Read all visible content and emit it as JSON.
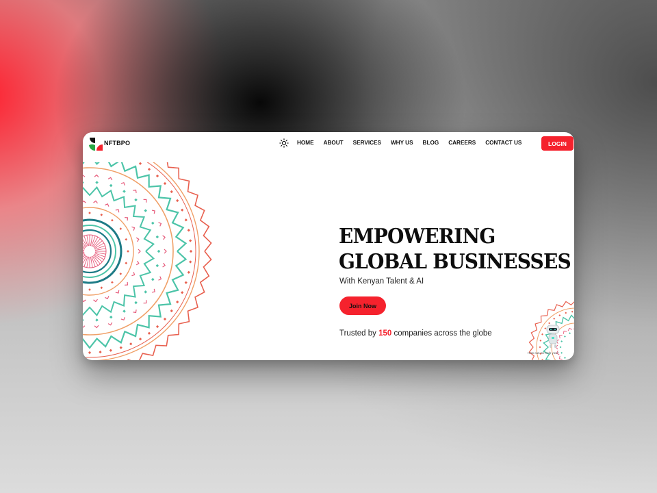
{
  "brand": {
    "name": "NFTBPO",
    "colors": {
      "red": "#f5222d",
      "green": "#27a844",
      "black": "#111111",
      "teal": "#4cc4a8",
      "coral": "#e8604f",
      "orange": "#f0a068",
      "pink": "#e65a7a",
      "deep_teal": "#1d7b86"
    }
  },
  "nav": {
    "theme_toggle_icon": "sun-icon",
    "links": [
      "HOME",
      "ABOUT",
      "SERVICES",
      "WHY US",
      "BLOG",
      "CAREERS",
      "CONTACT US"
    ],
    "login_label": "LOGIN"
  },
  "hero": {
    "title_line1": "EMPOWERING",
    "title_line2": "GLOBAL BUSINESSES",
    "subtitle": "With Kenyan Talent & AI",
    "cta_label": "Join Now",
    "trusted_prefix": "Trusted by",
    "trusted_count": "150",
    "trusted_suffix": "companies across the globe"
  },
  "chat_widget": {
    "caption": "How can we help you?"
  }
}
